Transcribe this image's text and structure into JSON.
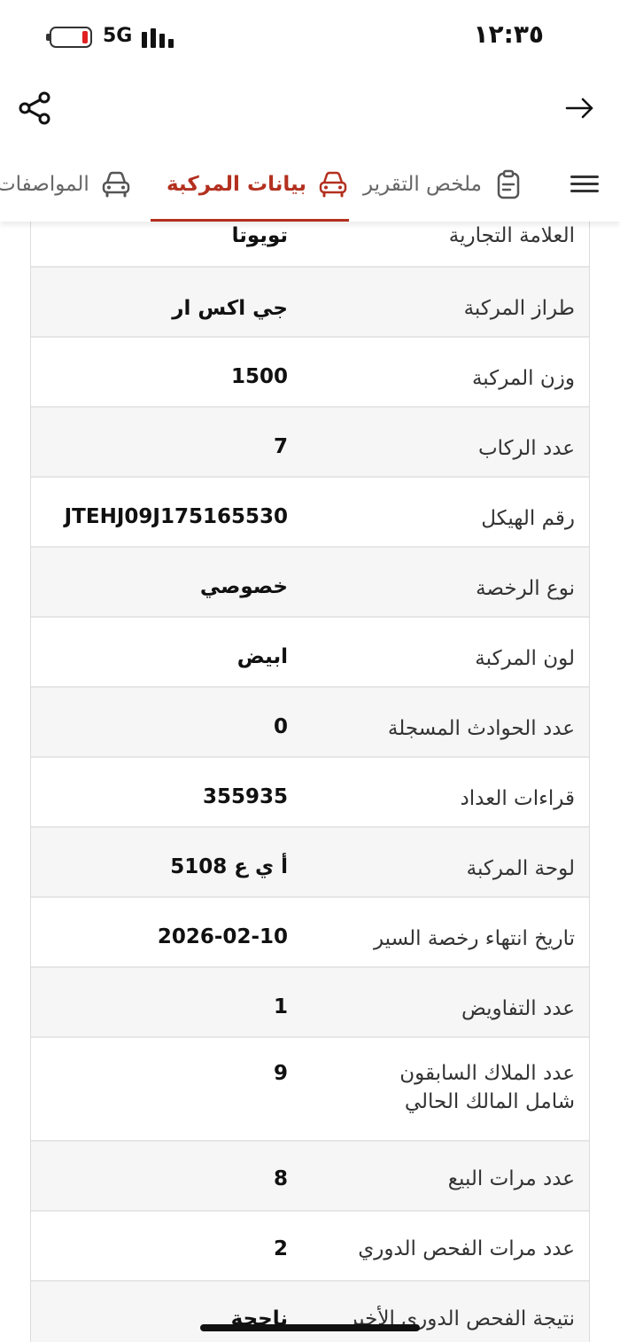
{
  "status_bar": {
    "time": "١٢:٣٥",
    "network": "5G"
  },
  "tabs": [
    {
      "label": "ملخص التقرير",
      "icon": "clipboard-icon"
    },
    {
      "label": "بيانات المركبة",
      "icon": "car-icon",
      "active": true
    },
    {
      "label": "المواصفات",
      "icon": "car-icon"
    }
  ],
  "rows": [
    {
      "label": "العلامة التجارية",
      "value": "تويوتا"
    },
    {
      "label": "طراز المركبة",
      "value": "جي اكس  ار"
    },
    {
      "label": "وزن المركبة",
      "value": "1500"
    },
    {
      "label": "عدد الركاب",
      "value": "7"
    },
    {
      "label": "رقم الهيكل",
      "value": "JTEHJ09J175165530"
    },
    {
      "label": "نوع الرخصة",
      "value": "خصوصي"
    },
    {
      "label": "لون المركبة",
      "value": "ابيض"
    },
    {
      "label": "عدد الحوادث المسجلة",
      "value": "0"
    },
    {
      "label": "قراءات العداد",
      "value": "355935"
    },
    {
      "label": "لوحة المركبة",
      "value": "أ ي ع 5108"
    },
    {
      "label": "تاريخ انتهاء رخصة السير",
      "value": "2026-02-10"
    },
    {
      "label": "عدد التفاويض",
      "value": "1"
    },
    {
      "label": "عدد الملاك السابقون شامل المالك الحالي",
      "value": "9"
    },
    {
      "label": "عدد مرات البيع",
      "value": "8"
    },
    {
      "label": "عدد مرات الفحص الدوري",
      "value": "2"
    },
    {
      "label": "نتيجة الفحص الدوري الأخير",
      "value": "ناجحة"
    }
  ],
  "colors": {
    "accent": "#b3301f",
    "battery_low": "#e02020"
  }
}
